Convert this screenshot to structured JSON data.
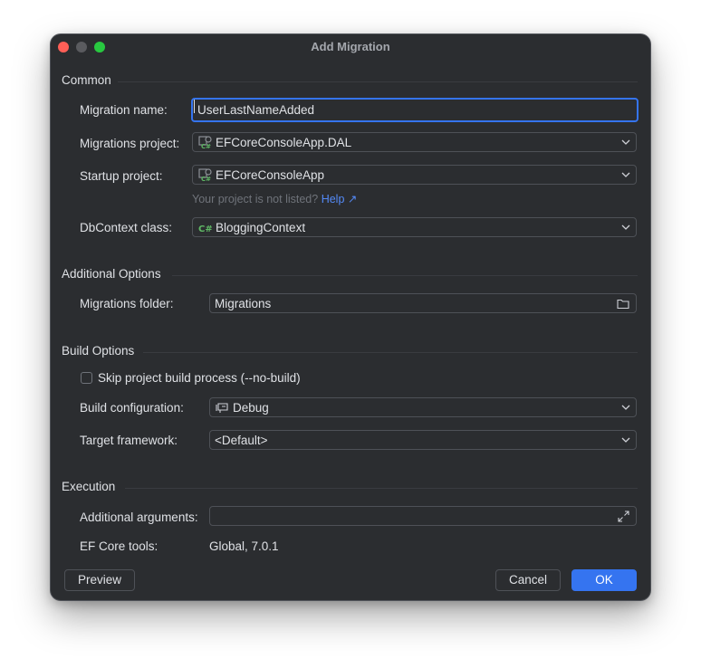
{
  "window": {
    "title": "Add Migration"
  },
  "sections": {
    "common": "Common",
    "additional": "Additional Options",
    "build": "Build Options",
    "execution": "Execution"
  },
  "fields": {
    "migration_name": {
      "label": "Migration name:",
      "value": "UserLastNameAdded"
    },
    "migrations_project": {
      "label": "Migrations project:",
      "value": "EFCoreConsoleApp.DAL",
      "icon": "csharp-project-icon"
    },
    "startup_project": {
      "label": "Startup project:",
      "value": "EFCoreConsoleApp",
      "icon": "csharp-project-icon"
    },
    "hint": {
      "text": "Your project is not listed?",
      "link": "Help ↗"
    },
    "dbcontext": {
      "label": "DbContext class:",
      "value": "BloggingContext",
      "icon": "csharp-class-icon"
    },
    "migrations_folder": {
      "label": "Migrations folder:",
      "value": "Migrations",
      "icon": "folder-icon"
    },
    "skip_build": {
      "label": "Skip project build process (--no-build)",
      "checked": false
    },
    "build_configuration": {
      "label": "Build configuration:",
      "value": "Debug",
      "icon": "configuration-icon"
    },
    "target_framework": {
      "label": "Target framework:",
      "value": "<Default>"
    },
    "additional_arguments": {
      "label": "Additional arguments:",
      "value": "",
      "icon": "expand-icon"
    },
    "ef_core_tools": {
      "label": "EF Core tools:",
      "value": "Global, 7.0.1"
    }
  },
  "buttons": {
    "preview": "Preview",
    "cancel": "Cancel",
    "ok": "OK"
  },
  "colors": {
    "background": "#2b2d30",
    "accent": "#3574f0",
    "link": "#548af7",
    "text": "#dfe1e5"
  }
}
